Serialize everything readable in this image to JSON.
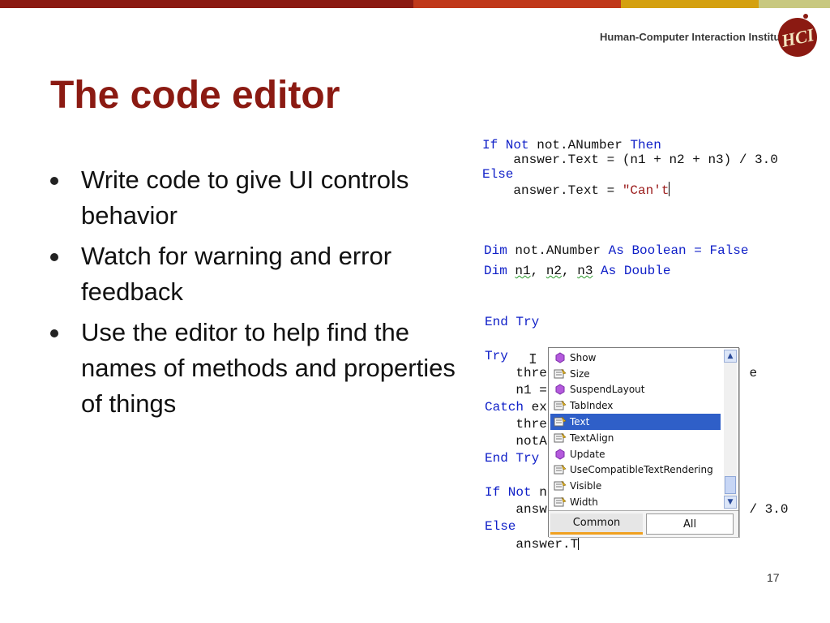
{
  "header": {
    "institute": "Human-Computer Interaction Institute",
    "bar_colors": [
      "#8b1a12",
      "#c0381a",
      "#d4a010",
      "#c8c880"
    ]
  },
  "slide": {
    "title": "The code editor",
    "bullets": [
      "Write code to give UI controls behavior",
      "Watch for warning and error feedback",
      "Use the editor to help find the names of methods and properties of things"
    ],
    "page_number": "17"
  },
  "code1": {
    "line1_kw1": "If Not",
    "line1_id": " not.ANumber ",
    "line1_kw2": "Then",
    "line2": "    answer.Text = (n1 + n2 + n3) / 3.0",
    "line3": "Else",
    "line4_pre": "    answer.Text = ",
    "line4_str": "\"Can't"
  },
  "code2": {
    "dim": "Dim",
    "n1": " not.ANumber ",
    "as": "As",
    "type1": " Boolean = False",
    "vars": [
      " ",
      "n1",
      ", ",
      "n2",
      ", ",
      "n3",
      " "
    ],
    "type2": " Double"
  },
  "code3": {
    "end_try": "End Try",
    "try": "Try",
    "l_thre1": "    thre",
    "l_thre1_tail": "e",
    "l_n1": "    n1 =",
    "catch": "Catch",
    "catch_tail": " ex",
    "l_thre2": "    thre",
    "l_notA": "    notA",
    "end_try2": "End Try",
    "if_not": "If Not",
    "if_tail": " n",
    "l_answ": "    answ",
    "answ_tail": "/ 3.0",
    "else": "Else",
    "l_last": "    answer.T"
  },
  "popup": {
    "items": [
      {
        "label": "Show",
        "icon": "method-icon"
      },
      {
        "label": "Size",
        "icon": "property-icon"
      },
      {
        "label": "SuspendLayout",
        "icon": "method-icon"
      },
      {
        "label": "TabIndex",
        "icon": "property-icon"
      },
      {
        "label": "Text",
        "icon": "property-icon",
        "selected": true
      },
      {
        "label": "TextAlign",
        "icon": "property-icon"
      },
      {
        "label": "Update",
        "icon": "method-icon"
      },
      {
        "label": "UseCompatibleTextRendering",
        "icon": "property-icon"
      },
      {
        "label": "Visible",
        "icon": "property-icon"
      },
      {
        "label": "Width",
        "icon": "property-icon"
      }
    ],
    "tab_common": "Common",
    "tab_all": "All"
  }
}
